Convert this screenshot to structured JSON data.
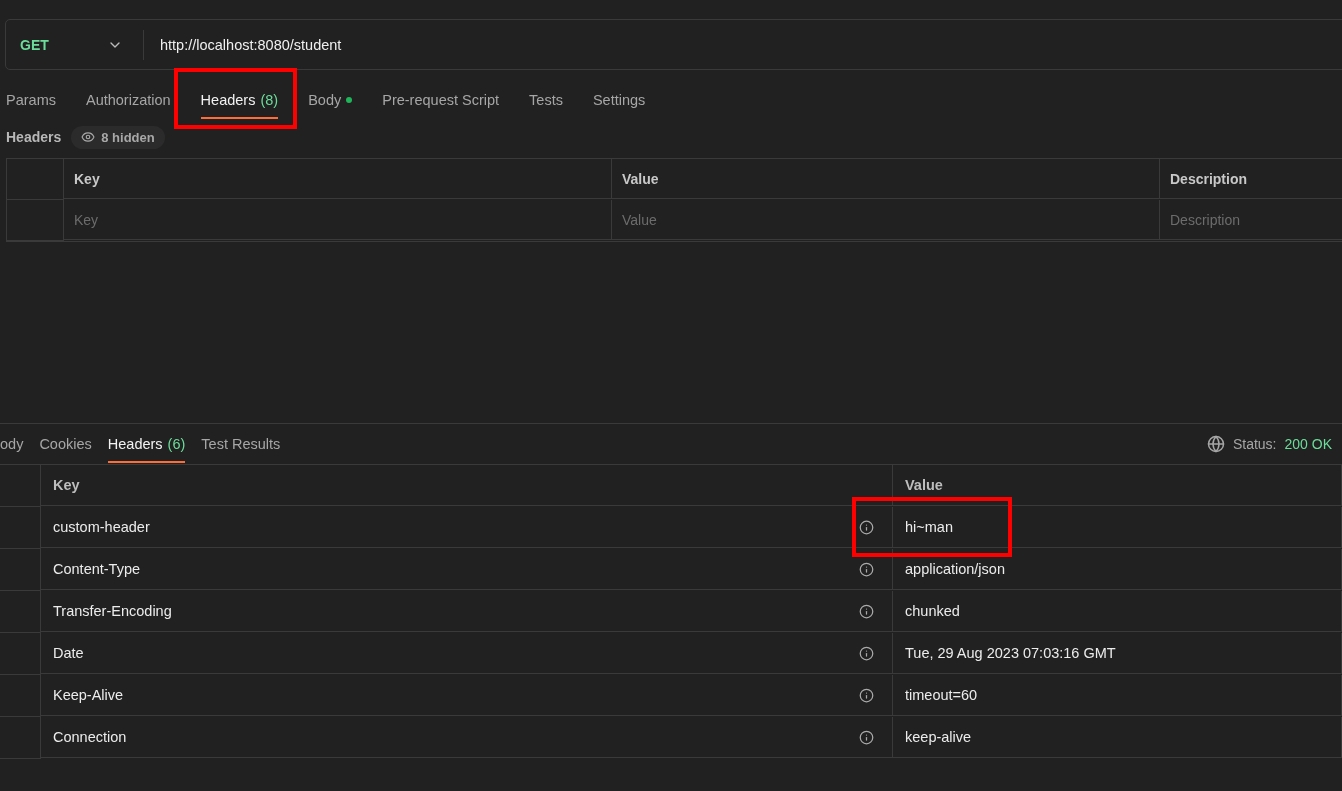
{
  "request": {
    "method": "GET",
    "url": "http://localhost:8080/student"
  },
  "request_tabs": [
    {
      "label": "Params",
      "selected": false
    },
    {
      "label": "Authorization",
      "selected": false
    },
    {
      "label": "Headers",
      "count": "(8)",
      "selected": true,
      "highlighted": true
    },
    {
      "label": "Body",
      "selected": false,
      "dot": true
    },
    {
      "label": "Pre-request Script",
      "selected": false
    },
    {
      "label": "Tests",
      "selected": false
    },
    {
      "label": "Settings",
      "selected": false
    }
  ],
  "headers_section": {
    "title": "Headers",
    "hidden_badge": "8 hidden"
  },
  "request_headers_table": {
    "columns": [
      "Key",
      "Value",
      "Description"
    ],
    "placeholders": [
      "Key",
      "Value",
      "Description"
    ]
  },
  "response_tabs": [
    {
      "label": "ody",
      "selected": false
    },
    {
      "label": "Cookies",
      "selected": false
    },
    {
      "label": "Headers",
      "count": "(6)",
      "selected": true
    },
    {
      "label": "Test Results",
      "selected": false
    }
  ],
  "status": {
    "label": "Status:",
    "value": "200 OK"
  },
  "response_headers": {
    "columns": [
      "Key",
      "Value"
    ],
    "rows": [
      {
        "key": "custom-header",
        "value": "hi~man",
        "highlighted": true
      },
      {
        "key": "Content-Type",
        "value": "application/json",
        "highlighted": false
      },
      {
        "key": "Transfer-Encoding",
        "value": "chunked",
        "highlighted": false
      },
      {
        "key": "Date",
        "value": "Tue, 29 Aug 2023 07:03:16 GMT",
        "highlighted": false
      },
      {
        "key": "Keep-Alive",
        "value": "timeout=60",
        "highlighted": false
      },
      {
        "key": "Connection",
        "value": "keep-alive",
        "highlighted": false
      }
    ]
  }
}
